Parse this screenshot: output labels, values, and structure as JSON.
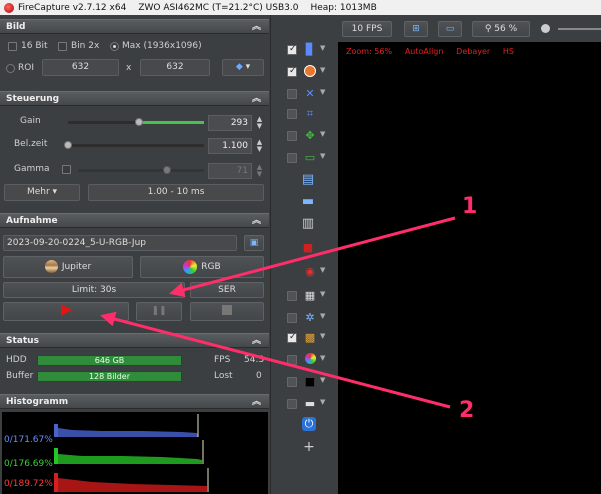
{
  "titlebar": {
    "app": "FireCapture v2.7.12 x64",
    "camera": "ZWO ASI462MC (T=21.2°C) USB3.0",
    "heap": "Heap: 1013MB"
  },
  "bild": {
    "header": "Bild",
    "bit16": "16 Bit",
    "bin2x": "Bin 2x",
    "max": "Max (1936x1096)",
    "roi": "ROI",
    "roi_w": "632",
    "roi_x": "x",
    "roi_h": "632"
  },
  "steuerung": {
    "header": "Steuerung",
    "gain_label": "Gain",
    "gain_value": "293",
    "gain_level": 0.52,
    "belzeit_label": "Bel.zeit",
    "belzeit_value": "1.100",
    "gamma_label": "Gamma",
    "gamma_value": "71",
    "mehr": "Mehr",
    "range": "1.00 - 10 ms"
  },
  "aufnahme": {
    "header": "Aufnahme",
    "filename": "2023-09-20-0224_5-U-RGB-Jup",
    "jupiter": "Jupiter",
    "rgb": "RGB",
    "limit": "Limit: 30s",
    "ser": "SER"
  },
  "status": {
    "header": "Status",
    "hdd_label": "HDD",
    "hdd_value": "646 GB",
    "fps_label": "FPS",
    "fps_value": "54.3",
    "buffer_label": "Buffer",
    "buffer_value": "128 Bilder",
    "lost_label": "Lost",
    "lost_value": "0"
  },
  "histogramm": {
    "header": "Histogramm",
    "blue": "0/171.67%",
    "green": "0/176.69%",
    "red": "0/189.72%"
  },
  "toolbar": {
    "fps": "10 FPS",
    "zoom": "56 %"
  },
  "overlay": {
    "zoom": "Zoom: 56%",
    "autoalign": "AutoAlign",
    "debayer": "Debayer",
    "hs": "HS"
  },
  "annotations": {
    "one": "1",
    "two": "2"
  },
  "colors": {
    "arrow": "#ff2e6a",
    "bar_green": "#2f8c3a",
    "slider_green": "#47c24a"
  }
}
